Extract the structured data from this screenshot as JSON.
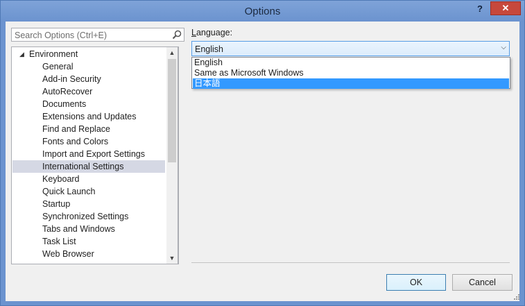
{
  "window": {
    "title": "Options",
    "help_label": "?",
    "close_label": "✕"
  },
  "search": {
    "placeholder": "Search Options (Ctrl+E)"
  },
  "tree": {
    "items": [
      {
        "label": "Environment",
        "level": 0,
        "expanded": true
      },
      {
        "label": "General",
        "level": 1
      },
      {
        "label": "Add-in Security",
        "level": 1
      },
      {
        "label": "AutoRecover",
        "level": 1
      },
      {
        "label": "Documents",
        "level": 1
      },
      {
        "label": "Extensions and Updates",
        "level": 1
      },
      {
        "label": "Find and Replace",
        "level": 1
      },
      {
        "label": "Fonts and Colors",
        "level": 1
      },
      {
        "label": "Import and Export Settings",
        "level": 1
      },
      {
        "label": "International Settings",
        "level": 1,
        "selected": true
      },
      {
        "label": "Keyboard",
        "level": 1
      },
      {
        "label": "Quick Launch",
        "level": 1
      },
      {
        "label": "Startup",
        "level": 1
      },
      {
        "label": "Synchronized Settings",
        "level": 1
      },
      {
        "label": "Tabs and Windows",
        "level": 1
      },
      {
        "label": "Task List",
        "level": 1
      },
      {
        "label": "Web Browser",
        "level": 1
      }
    ]
  },
  "language": {
    "label_accel": "L",
    "label_rest": "anguage:",
    "selected": "English",
    "options": [
      "English",
      "Same as Microsoft Windows",
      "日本語"
    ],
    "highlighted_option": "日本語"
  },
  "buttons": {
    "ok": "OK",
    "cancel": "Cancel"
  },
  "colors": {
    "title_bar": "#6e94cc",
    "close_button": "#c7483c",
    "selection_highlight": "#3399ff",
    "tree_selected": "#d5d8e4"
  }
}
